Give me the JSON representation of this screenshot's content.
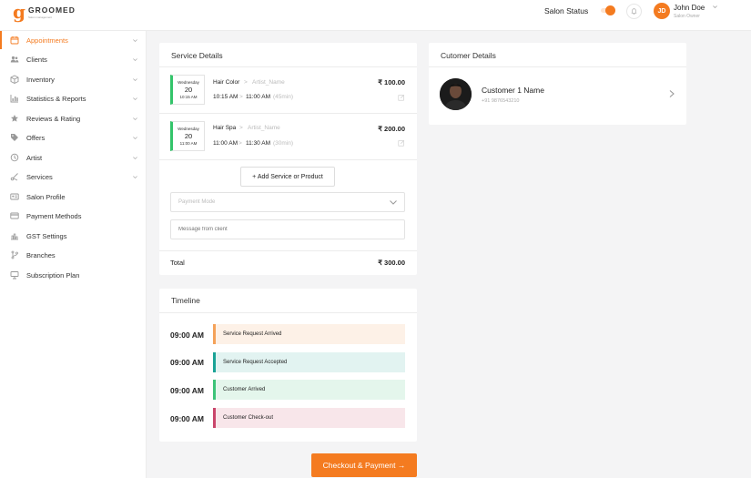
{
  "header": {
    "logo_letter": "g",
    "logo_name": "GROOMED",
    "logo_tagline": "Salon management",
    "salon_status_label": "Salon Status",
    "avatar_initials": "JD",
    "user_name": "John Doe",
    "user_role": "Salon Owner",
    "accent_color": "#f47b20"
  },
  "sidebar": {
    "items": [
      {
        "label": "Appointments",
        "icon": "calendar-icon",
        "active": true,
        "has_children": true
      },
      {
        "label": "Clients",
        "icon": "users-icon",
        "active": false,
        "has_children": true
      },
      {
        "label": "Inventory",
        "icon": "box-icon",
        "active": false,
        "has_children": true
      },
      {
        "label": "Statistics & Reports",
        "icon": "chart-icon",
        "active": false,
        "has_children": true
      },
      {
        "label": "Reviews & Rating",
        "icon": "star-icon",
        "active": false,
        "has_children": true
      },
      {
        "label": "Offers",
        "icon": "tag-icon",
        "active": false,
        "has_children": true
      },
      {
        "label": "Artist",
        "icon": "artist-icon",
        "active": false,
        "has_children": true
      },
      {
        "label": "Services",
        "icon": "scissors-icon",
        "active": false,
        "has_children": true
      },
      {
        "label": "Salon Profile",
        "icon": "profile-card-icon",
        "active": false,
        "has_children": false
      },
      {
        "label": "Payment Methods",
        "icon": "credit-card-icon",
        "active": false,
        "has_children": false
      },
      {
        "label": "GST Settings",
        "icon": "gst-icon",
        "active": false,
        "has_children": false
      },
      {
        "label": "Branches",
        "icon": "branch-icon",
        "active": false,
        "has_children": false
      },
      {
        "label": "Subscription Plan",
        "icon": "subscription-icon",
        "active": false,
        "has_children": false
      }
    ]
  },
  "service_details": {
    "title": "Service Details",
    "services": [
      {
        "weekday": "Wednesday",
        "day": "20",
        "time": "10:15 AM",
        "name": "Hair Color",
        "artist": "Artist_Name",
        "start": "10:15 AM",
        "end": "11:00 AM",
        "duration": "(45min)",
        "price": "₹ 100.00"
      },
      {
        "weekday": "Wednesday",
        "day": "20",
        "time": "11:00 AM",
        "name": "Hair Spa",
        "artist": "Artist_Name",
        "start": "11:00 AM",
        "end": "11:30 AM",
        "duration": "(30min)",
        "price": "₹ 200.00"
      }
    ],
    "add_button": "+ Add Service or Product",
    "payment_mode_placeholder": "Payment Mode",
    "message_placeholder": "Message from client",
    "total_label": "Total",
    "total_value": "₹ 300.00"
  },
  "timeline": {
    "title": "Timeline",
    "events": [
      {
        "time": "09:00 AM",
        "label": "Service Request Arrived",
        "color": "#f4a259",
        "bg": "#fdf1e7"
      },
      {
        "time": "09:00 AM",
        "label": "Service Request Accepted",
        "color": "#1aa396",
        "bg": "#e2f3f1"
      },
      {
        "time": "09:00 AM",
        "label": "Customer Arrived",
        "color": "#3cc378",
        "bg": "#e4f6ec"
      },
      {
        "time": "09:00 AM",
        "label": "Customer Check-out",
        "color": "#c9456b",
        "bg": "#f8e6ea"
      }
    ]
  },
  "customer_details": {
    "title": "Cutomer Details",
    "name": "Customer 1 Name",
    "phone": "+91 9876543210"
  },
  "checkout": {
    "label": "Checkout & Payment →"
  }
}
